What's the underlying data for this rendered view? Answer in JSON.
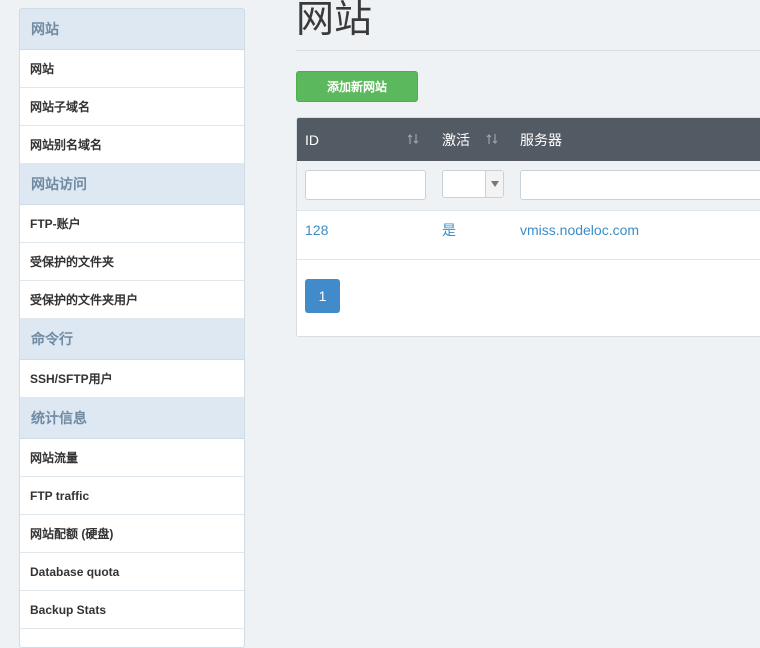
{
  "sidebar": {
    "sections": [
      {
        "title": "网站",
        "items": [
          "网站",
          "网站子域名",
          "网站别名域名"
        ]
      },
      {
        "title": "网站访问",
        "items": [
          "FTP-账户",
          "受保护的文件夹",
          "受保护的文件夹用户"
        ]
      },
      {
        "title": "命令行",
        "items": [
          "SSH/SFTP用户"
        ]
      },
      {
        "title": "统计信息",
        "items": [
          "网站流量",
          "FTP traffic",
          "网站配额 (硬盘)",
          "Database quota",
          "Backup Stats"
        ]
      }
    ]
  },
  "page": {
    "title": "网站",
    "add_button": "添加新网站"
  },
  "table": {
    "columns": [
      "ID",
      "激活",
      "服务器"
    ],
    "rows": [
      {
        "id": "128",
        "active": "是",
        "server": "vmiss.nodeloc.com"
      }
    ],
    "filter_select_value": ""
  },
  "pagination": {
    "current_page": "1"
  },
  "colors": {
    "accent_green": "#5cb85c",
    "link_blue": "#3b8ec6",
    "header_dark": "#525a63",
    "page_active": "#428bca"
  }
}
